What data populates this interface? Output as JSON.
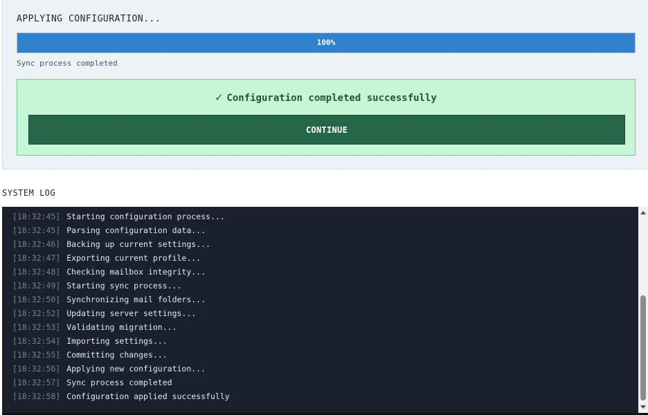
{
  "status": {
    "title": "APPLYING CONFIGURATION...",
    "progress_percent": 100,
    "progress_label": "100%",
    "subtext": "Sync process completed",
    "progress_color": "#3182ce"
  },
  "success": {
    "check_glyph": "✓",
    "message": "Configuration completed successfully",
    "continue_label": "CONTINUE",
    "box_color": "#c6f6d5",
    "button_color": "#276749"
  },
  "log": {
    "heading": "SYSTEM LOG",
    "entries": [
      {
        "time": "[18:32:45]",
        "message": "Starting configuration process..."
      },
      {
        "time": "[18:32:45]",
        "message": "Parsing configuration data..."
      },
      {
        "time": "[18:32:46]",
        "message": "Backing up current settings..."
      },
      {
        "time": "[18:32:47]",
        "message": "Exporting current profile..."
      },
      {
        "time": "[18:32:48]",
        "message": "Checking mailbox integrity..."
      },
      {
        "time": "[18:32:49]",
        "message": "Starting sync process..."
      },
      {
        "time": "[18:32:50]",
        "message": "Synchronizing mail folders..."
      },
      {
        "time": "[18:32:52]",
        "message": "Updating server settings..."
      },
      {
        "time": "[18:32:53]",
        "message": "Validating migration..."
      },
      {
        "time": "[18:32:54]",
        "message": "Importing settings..."
      },
      {
        "time": "[18:32:55]",
        "message": "Committing changes..."
      },
      {
        "time": "[18:32:56]",
        "message": "Applying new configuration..."
      },
      {
        "time": "[18:32:57]",
        "message": "Sync process completed"
      },
      {
        "time": "[18:32:58]",
        "message": "Configuration applied successfully"
      }
    ]
  }
}
